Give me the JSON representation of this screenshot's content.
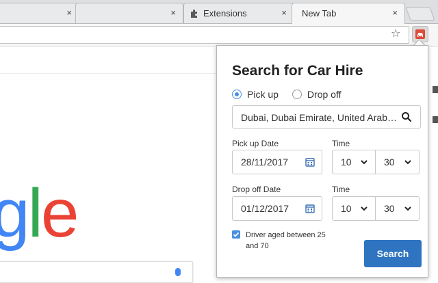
{
  "browser": {
    "tabs": [
      {
        "title": "",
        "close": "×"
      },
      {
        "title": "",
        "close": "×"
      },
      {
        "title": "Extensions",
        "close": "×",
        "icon": "puzzle-icon"
      },
      {
        "title": "New Tab",
        "close": "×",
        "active": true
      }
    ],
    "star": "☆"
  },
  "page": {
    "google_fragment": [
      {
        "char": "g",
        "color": "#4285f4"
      },
      {
        "char": "l",
        "color": "#34a853"
      },
      {
        "char": "e",
        "color": "#ea4335"
      }
    ]
  },
  "popup": {
    "title": "Search for Car Hire",
    "radios": [
      {
        "label": "Pick up",
        "checked": true
      },
      {
        "label": "Drop off",
        "checked": false
      }
    ],
    "location_value": "Dubai, Dubai Emirate, United Arab Emirates",
    "pickup": {
      "date_label": "Pick up Date",
      "date": "28/11/2017",
      "time_label": "Time",
      "hour": "10",
      "minute": "30"
    },
    "dropoff": {
      "date_label": "Drop off Date",
      "date": "01/12/2017",
      "time_label": "Time",
      "hour": "10",
      "minute": "30"
    },
    "driver_label": "Driver aged between 25 and 70",
    "driver_checked": true,
    "search_button": "Search",
    "accent_color": "#4a90e2",
    "button_color": "#2f74c0"
  }
}
